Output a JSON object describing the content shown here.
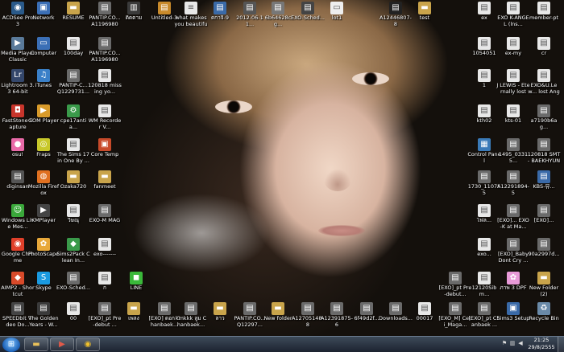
{
  "desktop_icons": [
    {
      "label": "ACDSee Pro 3",
      "icon": "acdsee-icon",
      "color": "#2a5a8a",
      "glyph": "◉"
    },
    {
      "label": "Network",
      "icon": "network-icon",
      "color": "#3b6fb6",
      "glyph": "▣"
    },
    {
      "label": "RESUME",
      "icon": "folder-icon",
      "color": "#c9a44b",
      "glyph": "▬"
    },
    {
      "label": "PANTIP.CO... A11969804...",
      "icon": "image-file-icon",
      "color": "#6a6a6a",
      "glyph": "▤"
    },
    {
      "label": "ติดตาม",
      "icon": "book-icon",
      "color": "#3a3a3a",
      "glyph": "▥"
    },
    {
      "label": "Untitled-3",
      "icon": "document-icon",
      "color": "#c88a2b",
      "glyph": "▤"
    },
    {
      "label": "what makes you beautiful",
      "icon": "text-file-icon",
      "color": "#e8e8e8",
      "glyph": "≡"
    },
    {
      "label": "ดกาจิ-9",
      "icon": "document-icon",
      "color": "#3a6aa8",
      "glyph": "▤"
    },
    {
      "label": "2012-06-11...",
      "icon": "image-file-icon",
      "color": "#555",
      "glyph": "▤"
    },
    {
      "label": "6b64628cg...",
      "icon": "image-file-icon",
      "color": "#777",
      "glyph": "▤"
    },
    {
      "label": "EXO-Sched...",
      "icon": "image-file-icon",
      "color": "#444",
      "glyph": "▤"
    },
    {
      "label": "lot1",
      "icon": "file-icon",
      "color": "#eee",
      "glyph": "▭"
    },
    {
      "label": "A12446807-8",
      "icon": "image-file-icon",
      "color": "#222",
      "glyph": "▤"
    },
    {
      "label": "test",
      "icon": "folder-icon",
      "color": "#c9a44b",
      "glyph": "▬"
    },
    {
      "label": "ex",
      "icon": "document-icon",
      "color": "#e8e8e8",
      "glyph": "▤"
    },
    {
      "label": "EXO K-ANGEL (lns...",
      "icon": "document-icon",
      "color": "#e8e8e8",
      "glyph": "▤"
    },
    {
      "label": "member-pt",
      "icon": "document-icon",
      "color": "#e8e8e8",
      "glyph": "▤"
    },
    {
      "label": "Media Player Classic",
      "icon": "media-player-icon",
      "color": "#5a7a9a",
      "glyph": "▶"
    },
    {
      "label": "Computer",
      "icon": "computer-icon",
      "color": "#3b6fb6",
      "glyph": "▭"
    },
    {
      "label": "100day",
      "icon": "document-icon",
      "color": "#e8e8e8",
      "glyph": "▤"
    },
    {
      "label": "PANTIP.CO... A11969804...",
      "icon": "image-file-icon",
      "color": "#6a6a6a",
      "glyph": "▤"
    },
    {
      "label": "1054051",
      "icon": "document-icon",
      "color": "#e8e8e8",
      "glyph": "▤"
    },
    {
      "label": "ex-my",
      "icon": "document-icon",
      "color": "#e8e8e8",
      "glyph": "▤"
    },
    {
      "label": "cr",
      "icon": "document-icon",
      "color": "#e8e8e8",
      "glyph": "▤"
    },
    {
      "label": "Lightroom 3.3 64-bit",
      "icon": "lightroom-icon",
      "color": "#34476b",
      "glyph": "Lr"
    },
    {
      "label": "iTunes",
      "icon": "itunes-icon",
      "color": "#3a80c8",
      "glyph": "♫"
    },
    {
      "label": "PANTIP-C... Q1229731...",
      "icon": "image-file-icon",
      "color": "#6a6a6a",
      "glyph": "▤"
    },
    {
      "label": "120818 missing yo...",
      "icon": "document-icon",
      "color": "#e8e8e8",
      "glyph": "▤"
    },
    {
      "label": "1",
      "icon": "document-icon",
      "color": "#e8e8e8",
      "glyph": "▤"
    },
    {
      "label": "J LEWIS - Eternally lost",
      "icon": "document-icon",
      "color": "#e8e8e8",
      "glyph": "▤"
    },
    {
      "label": "EXO&U.Lew... lost Angel...",
      "icon": "document-icon",
      "color": "#e8e8e8",
      "glyph": "▤"
    },
    {
      "label": "FastStone Capture",
      "icon": "faststone-icon",
      "color": "#c8352b",
      "glyph": "◘"
    },
    {
      "label": "GOM Player",
      "icon": "gom-player-icon",
      "color": "#d89a2a",
      "glyph": "▶"
    },
    {
      "label": "cpe17antia...",
      "icon": "program-icon",
      "color": "#3a9a4a",
      "glyph": "⚙"
    },
    {
      "label": "WM Recorder V...",
      "icon": "program-icon",
      "color": "#e8e8e8",
      "glyph": "▤"
    },
    {
      "label": "kth02",
      "icon": "document-icon",
      "color": "#e8e8e8",
      "glyph": "▤"
    },
    {
      "label": "kts-01",
      "icon": "document-icon",
      "color": "#e8e8e8",
      "glyph": "▤"
    },
    {
      "label": "a7190b6ag...",
      "icon": "image-file-icon",
      "color": "#6a6a6a",
      "glyph": "▤"
    },
    {
      "label": "osu!",
      "icon": "osu-icon",
      "color": "#e96aa8",
      "glyph": "●"
    },
    {
      "label": "Fraps",
      "icon": "fraps-icon",
      "color": "#c8c82a",
      "glyph": "◎"
    },
    {
      "label": "The Sims 17 in One By ...",
      "icon": "document-icon",
      "color": "#e8e8e8",
      "glyph": "▤"
    },
    {
      "label": "Core Temp",
      "icon": "core-temp-icon",
      "color": "#c84a2a",
      "glyph": "▣"
    },
    {
      "label": "Control Panel",
      "icon": "control-panel-icon",
      "color": "#3a7ab8",
      "glyph": "▦"
    },
    {
      "label": "1495_03315...",
      "icon": "image-file-icon",
      "color": "#6a6a6a",
      "glyph": "▤"
    },
    {
      "label": "120818 SMT - BAEKHYUN",
      "icon": "image-file-icon",
      "color": "#6a6a6a",
      "glyph": "▤"
    },
    {
      "label": "diginsan",
      "icon": "program-icon",
      "color": "#555",
      "glyph": "▤"
    },
    {
      "label": "Mozilla Firefox",
      "icon": "firefox-icon",
      "color": "#e07020",
      "glyph": "◍"
    },
    {
      "label": "Ozaka720",
      "icon": "folder-icon",
      "color": "#c9a44b",
      "glyph": "▬"
    },
    {
      "label": "fanmeet",
      "icon": "folder-icon",
      "color": "#c9a44b",
      "glyph": "▬"
    },
    {
      "label": "1730_110755",
      "icon": "image-file-icon",
      "color": "#6a6a6a",
      "glyph": "▤"
    },
    {
      "label": "A12291894-5",
      "icon": "image-file-icon",
      "color": "#6a6a6a",
      "glyph": "▤"
    },
    {
      "label": "KBS-뮤...",
      "icon": "image-file-icon",
      "color": "#3a6aa8",
      "glyph": "▤"
    },
    {
      "label": "Windows Live Mes...",
      "icon": "messenger-icon",
      "color": "#3aa83a",
      "glyph": "☺"
    },
    {
      "label": "KMPlayer",
      "icon": "kmplayer-icon",
      "color": "#444",
      "glyph": "▶"
    },
    {
      "label": "วิษณุ",
      "icon": "document-icon",
      "color": "#e8e8e8",
      "glyph": "▤"
    },
    {
      "label": "EXO-M MAG",
      "icon": "image-file-icon",
      "color": "#6a6a6a",
      "glyph": "▤"
    },
    {
      "label": "ไฟล...",
      "icon": "document-icon",
      "color": "#e8e8e8",
      "glyph": "▤"
    },
    {
      "label": "[EXO]... EXO-K at Ma...",
      "icon": "image-file-icon",
      "color": "#6a6a6a",
      "glyph": "▤"
    },
    {
      "label": "[EXO]...",
      "icon": "image-file-icon",
      "color": "#6a6a6a",
      "glyph": "▤"
    },
    {
      "label": "Google Chrome",
      "icon": "chrome-icon",
      "color": "#e0402a",
      "glyph": "◉"
    },
    {
      "label": "PhotoScape",
      "icon": "photoscape-icon",
      "color": "#e8a83a",
      "glyph": "✿"
    },
    {
      "label": "Sims2Pack Clean In...",
      "icon": "program-icon",
      "color": "#3a9a4a",
      "glyph": "◆"
    },
    {
      "label": "exo-------",
      "icon": "document-icon",
      "color": "#e8e8e8",
      "glyph": "▤"
    },
    {
      "label": "exo...",
      "icon": "document-icon",
      "color": "#e8e8e8",
      "glyph": "▤"
    },
    {
      "label": "[EXO]_Baby Dont Cry ...",
      "icon": "image-file-icon",
      "color": "#6a6a6a",
      "glyph": "▤"
    },
    {
      "label": "90a2997d...",
      "icon": "image-file-icon",
      "color": "#6a6a6a",
      "glyph": "▤"
    },
    {
      "label": "AIMP2 - Shortcut",
      "icon": "aimp-icon",
      "color": "#d84a2a",
      "glyph": "◆"
    },
    {
      "label": "Skype",
      "icon": "skype-icon",
      "color": "#1a9ae0",
      "glyph": "S"
    },
    {
      "label": "EXO-Sched...",
      "icon": "image-file-icon",
      "color": "#6a6a6a",
      "glyph": "▤"
    },
    {
      "label": "ก",
      "icon": "document-icon",
      "color": "#e8e8e8",
      "glyph": "▤"
    },
    {
      "label": "LINE",
      "icon": "line-icon",
      "color": "#3ab83a",
      "glyph": "◼"
    },
    {
      "label": "[EXO]_pt Pre-debut...",
      "icon": "image-file-icon",
      "color": "#6a6a6a",
      "glyph": "▤"
    },
    {
      "label": "12120Sibm...",
      "icon": "document-icon",
      "color": "#e8e8e8",
      "glyph": "▤"
    },
    {
      "label": "ภาพ 3 DPF",
      "icon": "image-file-icon",
      "color": "#e89ad8",
      "glyph": "✿"
    },
    {
      "label": "New Folder (2)",
      "icon": "folder-icon",
      "color": "#c9a44b",
      "glyph": "▬"
    },
    {
      "label": "SPEEDbit Video Do...",
      "icon": "program-icon",
      "color": "#444",
      "glyph": "▤"
    },
    {
      "label": "The Golden Years - W...",
      "icon": "program-icon",
      "color": "#3a3a3a",
      "glyph": "▤"
    },
    {
      "label": "00",
      "icon": "document-icon",
      "color": "#e8e8e8",
      "glyph": "▤"
    },
    {
      "label": "[EXO]_pt Pre-debut ...",
      "icon": "image-file-icon",
      "color": "#6a6a6a",
      "glyph": "▤"
    },
    {
      "label": "เพลง",
      "icon": "folder-icon",
      "color": "#c9a44b",
      "glyph": "▬"
    },
    {
      "label": "[EXO] ดอก Chanbaek...",
      "icon": "image-file-icon",
      "color": "#6a6a6a",
      "glyph": "▤"
    },
    {
      "label": "kmkkk ลูม Chanbaek...",
      "icon": "image-file-icon",
      "color": "#6a6a6a",
      "glyph": "▤"
    },
    {
      "label": "ลาว",
      "icon": "folder-icon",
      "color": "#c9a44b",
      "glyph": "▬"
    },
    {
      "label": "PANTIP.CO... Q12297...",
      "icon": "image-file-icon",
      "color": "#6a6a6a",
      "glyph": "▤"
    },
    {
      "label": "New folder",
      "icon": "folder-icon",
      "color": "#c9a44b",
      "glyph": "▬"
    },
    {
      "label": "A12705148-8",
      "icon": "image-file-icon",
      "color": "#6a6a6a",
      "glyph": "▤"
    },
    {
      "label": "A12391875-6",
      "icon": "image-file-icon",
      "color": "#6a6a6a",
      "glyph": "▤"
    },
    {
      "label": "6f49d2f...",
      "icon": "image-file-icon",
      "color": "#6a6a6a",
      "glyph": "▤"
    },
    {
      "label": "Downloads...",
      "icon": "image-file-icon",
      "color": "#6a6a6a",
      "glyph": "▤"
    },
    {
      "label": "00017",
      "icon": "document-icon",
      "color": "#e8e8e8",
      "glyph": "▤"
    },
    {
      "label": "[EXO_M] Ceci_Maga...",
      "icon": "image-file-icon",
      "color": "#6a6a6a",
      "glyph": "▤"
    },
    {
      "label": "[EXO]_pt Chanbaek ...",
      "icon": "image-file-icon",
      "color": "#6a6a6a",
      "glyph": "▤"
    },
    {
      "label": "Sims3 Setup",
      "icon": "setup-icon",
      "color": "#3a6aa8",
      "glyph": "▣"
    },
    {
      "label": "Recycle Bin",
      "icon": "recycle-bin-icon",
      "color": "#6a8aa8",
      "glyph": "♻"
    }
  ],
  "taskbar": {
    "start_label": "Start",
    "pinned": [
      {
        "name": "explorer",
        "icon": "folder-explorer-icon",
        "glyph": "▬"
      },
      {
        "name": "media",
        "icon": "media-player-taskbar-icon",
        "glyph": "▶"
      },
      {
        "name": "chrome",
        "icon": "chrome-taskbar-icon",
        "glyph": "◉"
      }
    ],
    "tray_icons": [
      "flag-icon",
      "network-tray-icon",
      "volume-icon",
      "battery-icon"
    ],
    "clock": {
      "time": "21:25",
      "date": "29/8/2555"
    }
  }
}
